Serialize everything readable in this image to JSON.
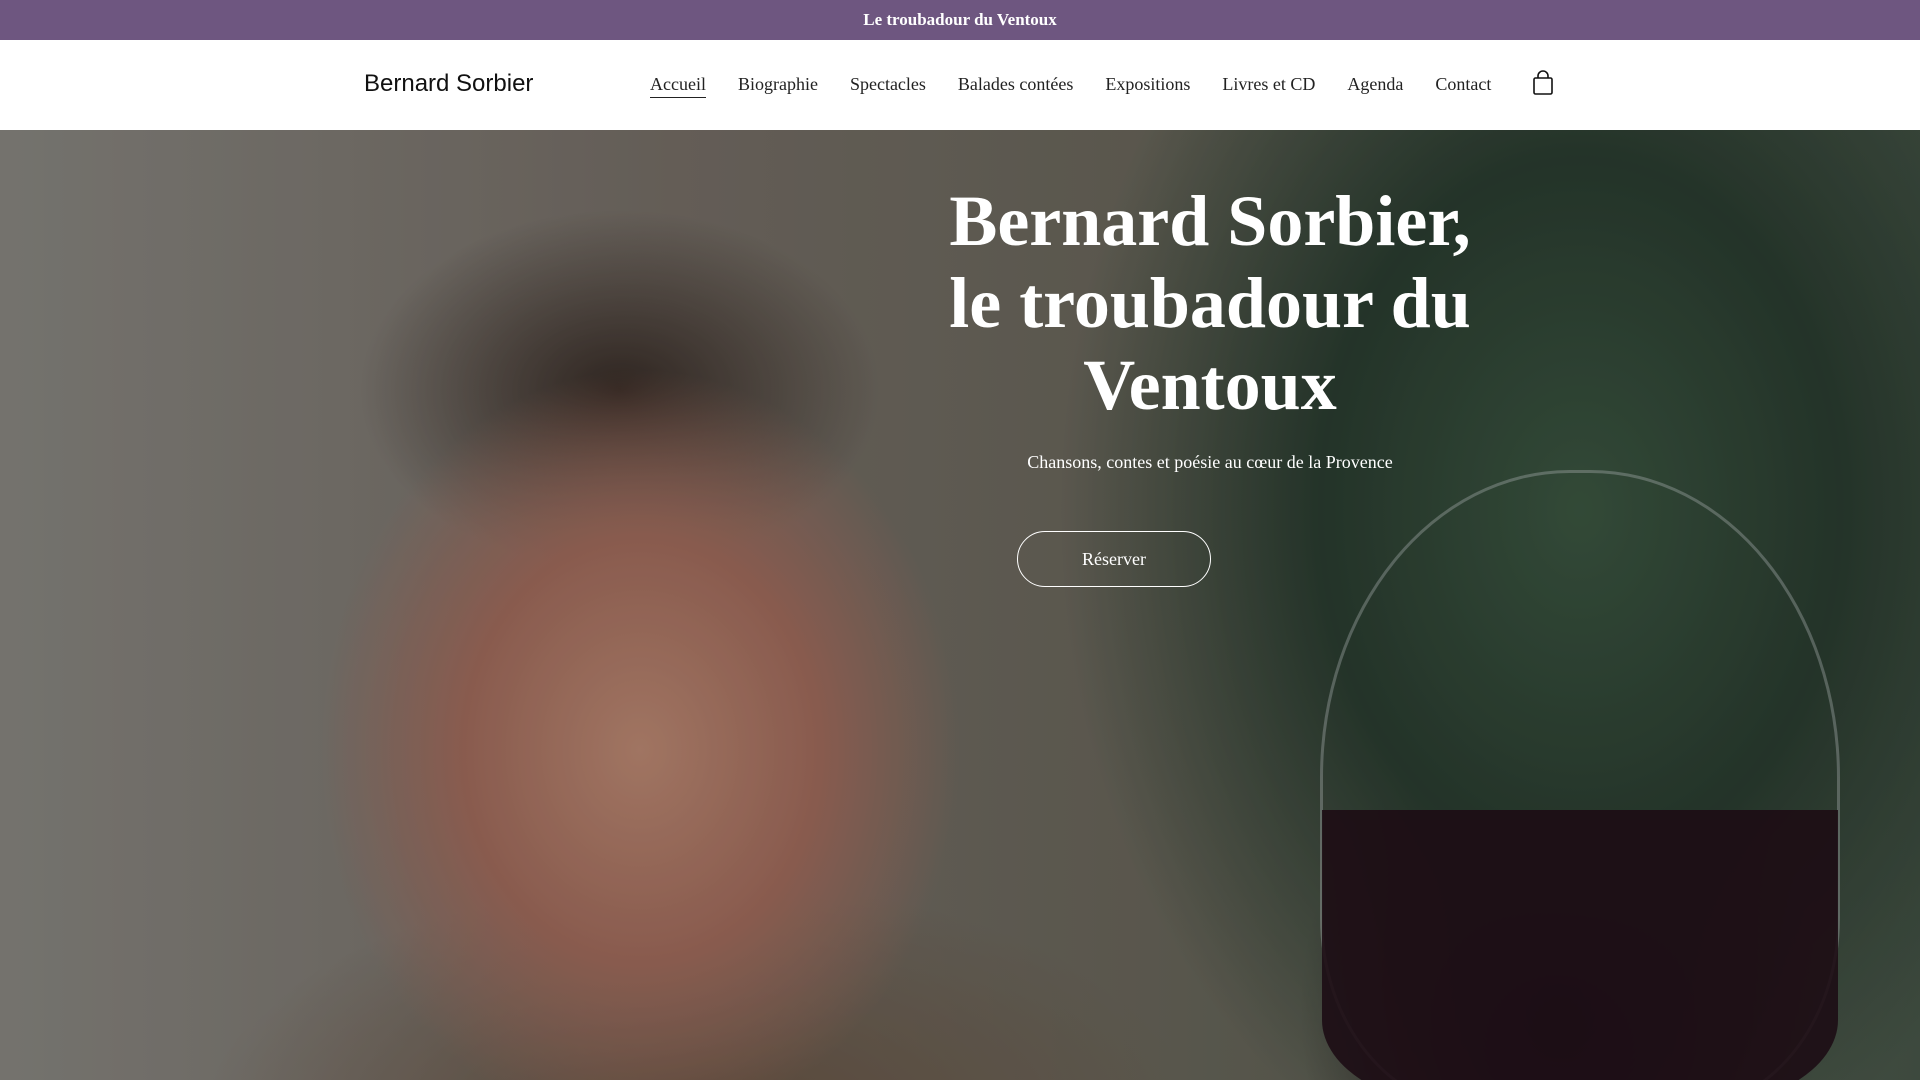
{
  "announcement": {
    "text": "Le troubadour du Ventoux"
  },
  "header": {
    "brand": "Bernard Sorbier",
    "nav": [
      {
        "label": "Accueil",
        "active": true
      },
      {
        "label": "Biographie"
      },
      {
        "label": "Spectacles"
      },
      {
        "label": "Balades contées"
      },
      {
        "label": "Expositions"
      },
      {
        "label": "Livres et CD"
      },
      {
        "label": "Agenda"
      },
      {
        "label": "Contact"
      }
    ],
    "cart_icon": "shopping-bag-icon"
  },
  "hero": {
    "title_lines": [
      "Bernard Sorbier,",
      "le troubadour du",
      "Ventoux"
    ],
    "subtitle": "Chansons, contes et poésie au cœur de la Provence",
    "button_label": "Réserver"
  },
  "colors": {
    "announcement_bg": "#6e5680",
    "header_bg": "#ffffff",
    "hero_text": "#ffffff"
  }
}
